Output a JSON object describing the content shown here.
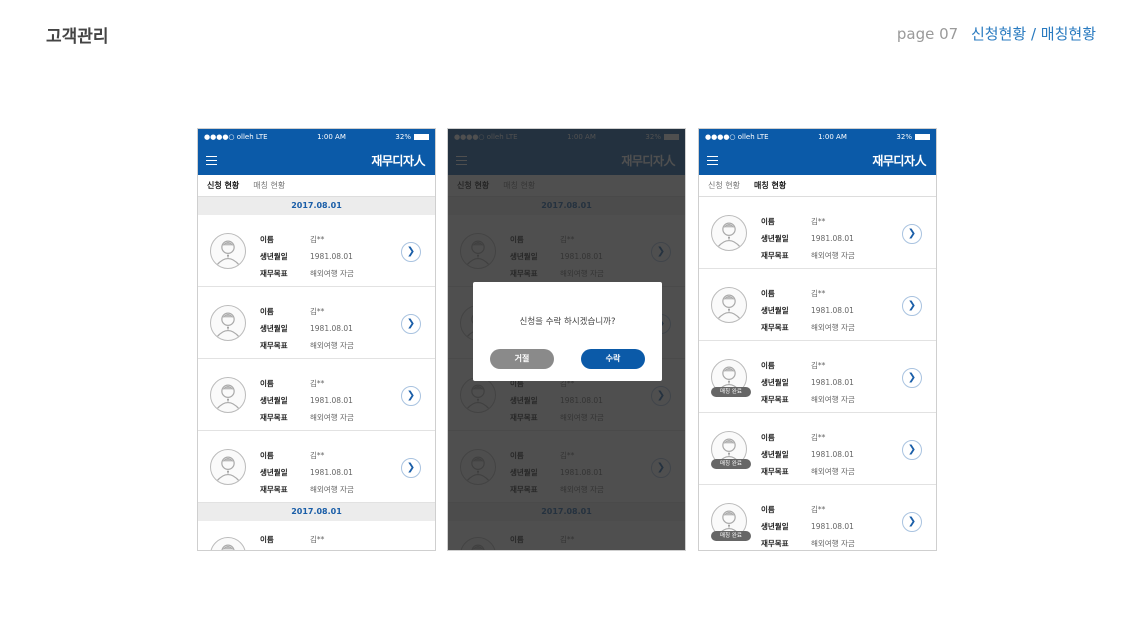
{
  "header": {
    "title": "고객관리",
    "page_number": "page 07",
    "breadcrumb": "신청현황 / 매칭현황"
  },
  "status_bar": {
    "signal": "●●●●○ olleh LTE",
    "time": "1:00 AM",
    "battery": "32%"
  },
  "app": {
    "logo": "재무디자人"
  },
  "tabs": {
    "apply": "신청 현황",
    "match": "매칭 현황"
  },
  "phone1": {
    "date1": "2017.08.01",
    "date2": "2017.08.01",
    "items": [
      {
        "name": "김**",
        "birth": "1981.08.01",
        "goal": "해외여행 자금"
      },
      {
        "name": "김**",
        "birth": "1981.08.01",
        "goal": "해외여행 자금"
      },
      {
        "name": "김**",
        "birth": "1981.08.01",
        "goal": "해외여행 자금"
      },
      {
        "name": "김**",
        "birth": "1981.08.01",
        "goal": "해외여행 자금"
      }
    ],
    "partial_name": "김**"
  },
  "labels": {
    "name": "이름",
    "birth": "생년월일",
    "goal": "재무목표"
  },
  "dialog": {
    "message": "신청을 수락 하시겠습니까?",
    "reject": "거절",
    "accept": "수락"
  },
  "phone3": {
    "badge": "매칭 완료",
    "items": [
      {
        "name": "김**",
        "birth": "1981.08.01",
        "goal": "해외여행 자금",
        "matched": false
      },
      {
        "name": "김**",
        "birth": "1981.08.01",
        "goal": "해외여행 자금",
        "matched": false
      },
      {
        "name": "김**",
        "birth": "1981.08.01",
        "goal": "해외여행 자금",
        "matched": true
      },
      {
        "name": "김**",
        "birth": "1981.08.01",
        "goal": "해외여행 자금",
        "matched": true
      },
      {
        "name": "김**",
        "birth": "1981.08.01",
        "goal": "해외여행 자금",
        "matched": true
      }
    ]
  },
  "colors": {
    "brand": "#0b5aa8",
    "breadcrumb": "#2a7bc0"
  }
}
